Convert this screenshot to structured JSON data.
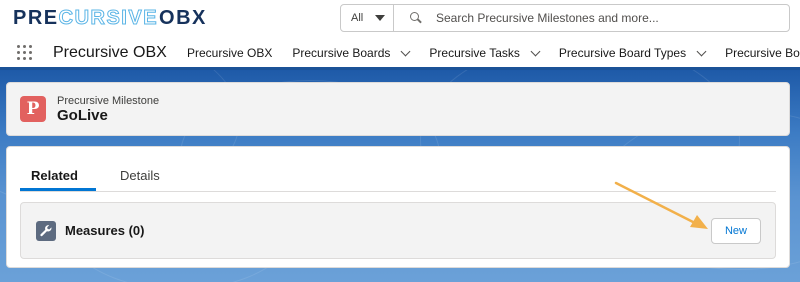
{
  "header": {
    "logo_part1": "PRE",
    "logo_part2": "CURSIVE",
    "logo_part3": "OBX",
    "search": {
      "scope": "All",
      "placeholder": "Search Precursive Milestones and more..."
    }
  },
  "nav": {
    "app_name": "Precursive OBX",
    "items": [
      {
        "label": "Precursive OBX",
        "has_menu": false
      },
      {
        "label": "Precursive Boards",
        "has_menu": true
      },
      {
        "label": "Precursive Tasks",
        "has_menu": true
      },
      {
        "label": "Precursive Board Types",
        "has_menu": true
      },
      {
        "label": "Precursive Board P",
        "has_menu": false
      }
    ]
  },
  "record": {
    "icon_letter": "P",
    "type_label": "Precursive Milestone",
    "name": "GoLive"
  },
  "tabs": [
    {
      "label": "Related",
      "active": true
    },
    {
      "label": "Details",
      "active": false
    }
  ],
  "related_list": {
    "title": "Measures (0)",
    "icon": "wrench-icon",
    "new_button_label": "New"
  },
  "colors": {
    "brand_navy": "#16325c",
    "brand_cyan": "#5ab4e6",
    "accent_blue": "#0176d3",
    "record_icon": "#e2615f",
    "annotation_arrow": "#f2b04a"
  }
}
